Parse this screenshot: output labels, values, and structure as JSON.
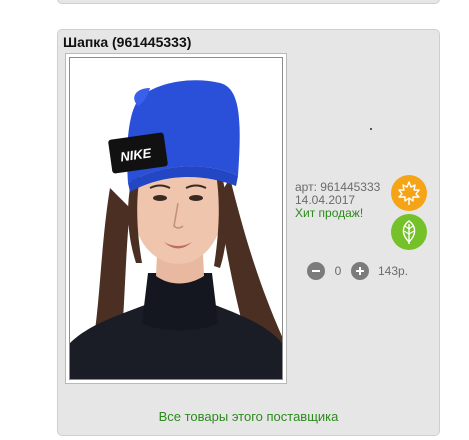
{
  "product": {
    "title": "Шапка (961445333)",
    "article_label": "арт:",
    "article_value": "961445333",
    "date": "14.04.2017",
    "hit_label": "Хит продаж!",
    "quantity": "0",
    "price": "143р.",
    "supplier_link": "Все товары этого поставщика",
    "photo": {
      "hat_logo_text": "NIKE"
    }
  },
  "badges": {
    "season": {
      "icon": "maple-leaf-icon",
      "color": "#f6a417"
    },
    "eco": {
      "icon": "leaf-icon",
      "color": "#74c129"
    }
  },
  "colors": {
    "card_background": "#e6e6e6",
    "link_green": "#2c8a1d",
    "hat_blue": "#2a4fd9"
  }
}
